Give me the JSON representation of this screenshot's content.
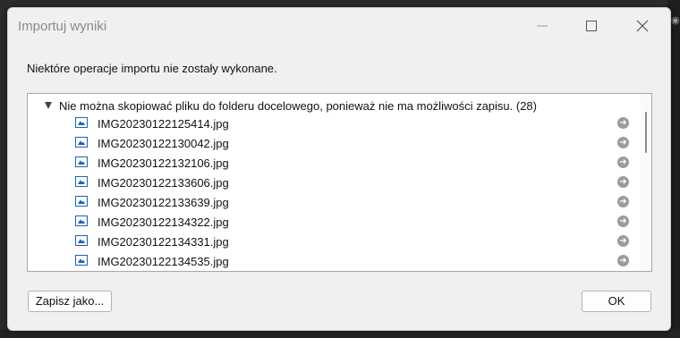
{
  "window": {
    "title": "Importuj wyniki"
  },
  "message": "Niektóre operacje importu nie zostały wykonane.",
  "group": {
    "header": "Nie można skopiować pliku do folderu docelowego, ponieważ nie ma możliwości zapisu. (28)",
    "files": [
      "IMG20230122125414.jpg",
      "IMG20230122130042.jpg",
      "IMG20230122132106.jpg",
      "IMG20230122133606.jpg",
      "IMG20230122133639.jpg",
      "IMG20230122134322.jpg",
      "IMG20230122134331.jpg",
      "IMG20230122134535.jpg"
    ]
  },
  "buttons": {
    "save_as": "Zapisz jako...",
    "ok": "OK"
  },
  "icons": {
    "file": "image-file-icon",
    "go": "go-to-arrow-icon",
    "expand": "collapse-triangle-icon"
  },
  "colors": {
    "accent": "#1d63b1",
    "dialog_bg": "#f0f0f0"
  }
}
